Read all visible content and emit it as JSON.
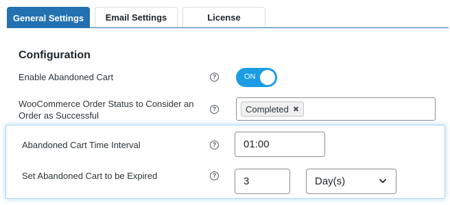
{
  "tabs": [
    {
      "label": "General Settings",
      "active": true
    },
    {
      "label": "Email Settings",
      "active": false
    },
    {
      "label": "License",
      "active": false
    }
  ],
  "section": {
    "title": "Configuration"
  },
  "settings": {
    "enable_cart": {
      "label": "Enable Abandoned Cart",
      "help": "?",
      "toggle_label": "ON",
      "enabled": true
    },
    "order_status": {
      "label": "WooCommerce Order Status to Consider an Order as Successful",
      "help": "?",
      "selected": [
        "Completed"
      ],
      "remove_glyph": "✖"
    },
    "time_interval": {
      "label": "Abandoned Cart Time Interval",
      "help": "?",
      "value": "01:00"
    },
    "expire": {
      "label": "Set Abandoned Cart to be Expired",
      "help": "?",
      "value": "3",
      "unit": "Day(s)"
    }
  },
  "colors": {
    "accent": "#2271b1",
    "toggle_on": "#1b9ce5",
    "highlight_border": "#a7d8f5"
  },
  "icons": {
    "help": "help-circle-icon",
    "remove": "close-icon",
    "dropdown": "chevron-down-icon"
  }
}
